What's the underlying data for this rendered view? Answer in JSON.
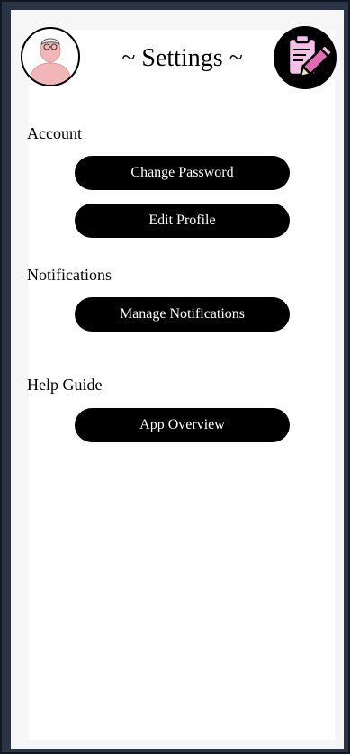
{
  "header": {
    "title": "~ Settings ~",
    "avatar_icon": "user-avatar-icon",
    "edit_icon": "notepad-pencil-icon"
  },
  "sections": {
    "account": {
      "label": "Account",
      "buttons": [
        "Change Password",
        "Edit Profile"
      ]
    },
    "notifications": {
      "label": "Notifications",
      "buttons": [
        "Manage Notifications"
      ]
    },
    "help": {
      "label": "Help Guide",
      "buttons": [
        "App Overview"
      ]
    }
  },
  "colors": {
    "button_bg": "#000000",
    "button_text": "#ffffff",
    "avatar_face": "#f2b6b8",
    "edit_icon_bg": "#f3c0e8"
  }
}
